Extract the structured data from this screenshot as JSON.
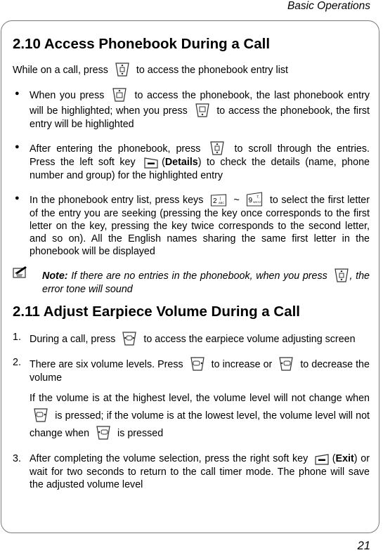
{
  "header": {
    "title": "Basic Operations"
  },
  "footer": {
    "page_number": "21"
  },
  "section_210": {
    "heading": "2.10 Access Phonebook During a Call",
    "intro": {
      "before": "While on a call, press",
      "icon": "up-down-navigation-key-icon",
      "after": "to access the phonebook entry list"
    },
    "bullets": [
      {
        "p1": "When you press",
        "icon1": "up-navigation-key-icon",
        "p2": "to access the phonebook, the last phonebook entry will be highlighted; when you press",
        "icon2": "down-navigation-key-icon",
        "p3": "to access the phonebook, the first entry will be highlighted"
      },
      {
        "p1": "After entering the phonebook, press",
        "icon1": "up-down-navigation-key-icon",
        "p2": "to scroll through the entries. Press the left soft key",
        "icon2": "left-soft-key-icon",
        "p3_open": "(",
        "bold": "Details",
        "p3_close": ") to check the details (name, phone number and group) for the highlighted entry"
      },
      {
        "p1": "In the phonebook entry list, press keys",
        "icon1": "key-2-abc-icon",
        "sep": "~",
        "icon2": "key-9-wxyz-icon",
        "p2": "to select the first letter of the entry you are seeking (pressing the key once corresponds to the first letter on the key, pressing the key twice corresponds to the second letter, and so on). All the English names sharing the same first letter in the phonebook will be displayed"
      }
    ],
    "note": {
      "label": "Note:",
      "p1": "If there are no entries in the phonebook, when you press",
      "icon": "up-down-navigation-key-icon",
      "p2": ", the error tone will sound"
    }
  },
  "section_211": {
    "heading": "2.11 Adjust Earpiece Volume During a Call",
    "steps": [
      {
        "n": "1.",
        "p1": "During a call, press",
        "icon1": "left-right-navigation-key-icon",
        "p2": "to access the earpiece volume adjusting screen"
      },
      {
        "n": "2.",
        "p1": "There are six volume levels. Press",
        "icon1": "right-navigation-key-icon",
        "p2": "to increase or",
        "icon2": "left-navigation-key-icon",
        "p3": "to decrease the volume",
        "sub": {
          "p1": "If the volume is at the highest level, the volume level will not change when",
          "icon1": "right-navigation-key-icon",
          "p2": "is pressed; if the volume is at the lowest level, the volume level will not change when",
          "icon2": "left-navigation-key-icon",
          "p3": "is pressed"
        }
      },
      {
        "n": "3.",
        "p1": "After completing the volume selection, press the right soft key",
        "icon1": "right-soft-key-icon",
        "p2_open": "(",
        "bold": "Exit",
        "p2_close": ") or wait for two seconds to return to the call timer mode. The phone will save the adjusted volume level"
      }
    ]
  }
}
